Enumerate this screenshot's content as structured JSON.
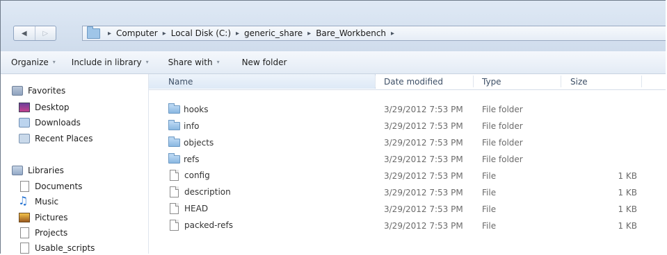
{
  "address_bar": {
    "back_icon": "◀",
    "forward_icon": "▷",
    "separator": "▸",
    "breadcrumbs": [
      "Computer",
      "Local Disk (C:)",
      "generic_share",
      "Bare_Workbench"
    ]
  },
  "toolbar": {
    "organize_label": "Organize",
    "include_label": "Include in library",
    "share_label": "Share with",
    "new_folder_label": "New folder",
    "dropdown_arrow": "▾"
  },
  "nav": {
    "favorites": {
      "label": "Favorites",
      "items": [
        {
          "label": "Desktop",
          "icon": "desktop-icon"
        },
        {
          "label": "Downloads",
          "icon": "downloads-icon"
        },
        {
          "label": "Recent Places",
          "icon": "recent-places-icon"
        }
      ]
    },
    "libraries": {
      "label": "Libraries",
      "items": [
        {
          "label": "Documents",
          "icon": "documents-icon"
        },
        {
          "label": "Music",
          "icon": "music-icon"
        },
        {
          "label": "Pictures",
          "icon": "pictures-icon"
        },
        {
          "label": "Projects",
          "icon": "projects-icon"
        },
        {
          "label": "Usable_scripts",
          "icon": "scripts-icon"
        }
      ]
    }
  },
  "columns": {
    "name": "Name",
    "date": "Date modified",
    "type": "Type",
    "size": "Size"
  },
  "files": [
    {
      "name": "hooks",
      "date": "3/29/2012 7:53 PM",
      "type": "File folder",
      "size": "",
      "kind": "folder"
    },
    {
      "name": "info",
      "date": "3/29/2012 7:53 PM",
      "type": "File folder",
      "size": "",
      "kind": "folder"
    },
    {
      "name": "objects",
      "date": "3/29/2012 7:53 PM",
      "type": "File folder",
      "size": "",
      "kind": "folder"
    },
    {
      "name": "refs",
      "date": "3/29/2012 7:53 PM",
      "type": "File folder",
      "size": "",
      "kind": "folder"
    },
    {
      "name": "config",
      "date": "3/29/2012 7:53 PM",
      "type": "File",
      "size": "1 KB",
      "kind": "file"
    },
    {
      "name": "description",
      "date": "3/29/2012 7:53 PM",
      "type": "File",
      "size": "1 KB",
      "kind": "file"
    },
    {
      "name": "HEAD",
      "date": "3/29/2012 7:53 PM",
      "type": "File",
      "size": "1 KB",
      "kind": "file"
    },
    {
      "name": "packed-refs",
      "date": "3/29/2012 7:53 PM",
      "type": "File",
      "size": "1 KB",
      "kind": "file"
    }
  ],
  "colors": {
    "header_text": "#3d4f66",
    "folder_blue": "#8ab7e1",
    "window_chrome": "#dfe9f5"
  }
}
